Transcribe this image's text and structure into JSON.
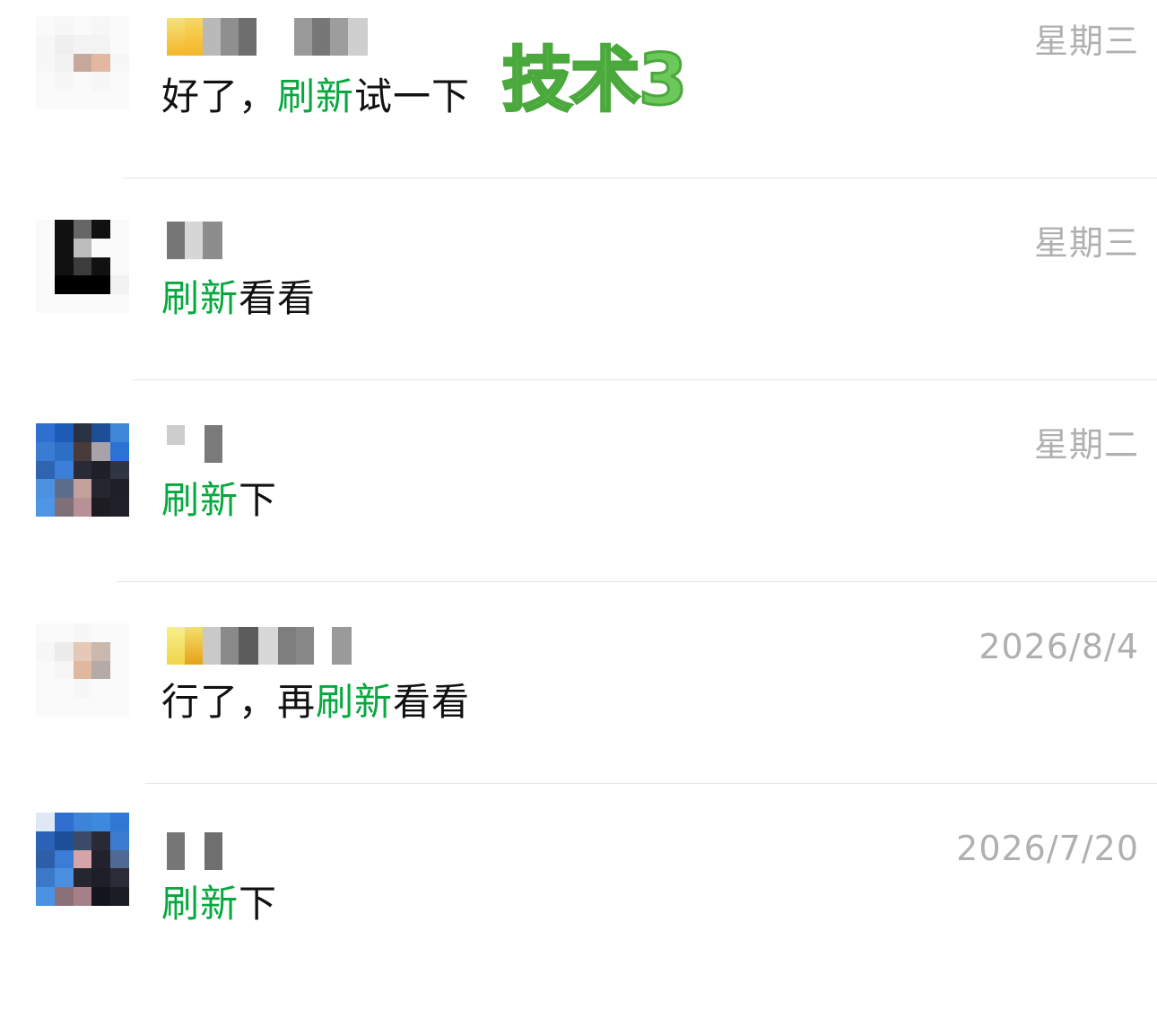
{
  "watermark": "技术3",
  "colors": {
    "keyword": "#07a83f",
    "time": "#b0b0b0",
    "text": "#111111",
    "stamp": "#6cc85a"
  },
  "chats": [
    {
      "message_parts": [
        "好了，",
        "刷新",
        "试一下"
      ],
      "keyword_index": 1,
      "time": "星期三"
    },
    {
      "message_parts": [
        "",
        "刷新",
        "看看"
      ],
      "keyword_index": 1,
      "time": "星期三"
    },
    {
      "message_parts": [
        "",
        "刷新",
        "下"
      ],
      "keyword_index": 1,
      "time": "星期二"
    },
    {
      "message_parts": [
        "行了，再",
        "刷新",
        "看看"
      ],
      "keyword_index": 1,
      "time": "2026/8/4"
    },
    {
      "message_parts": [
        "",
        "刷新",
        "下"
      ],
      "keyword_index": 1,
      "time": "2026/7/20"
    }
  ]
}
